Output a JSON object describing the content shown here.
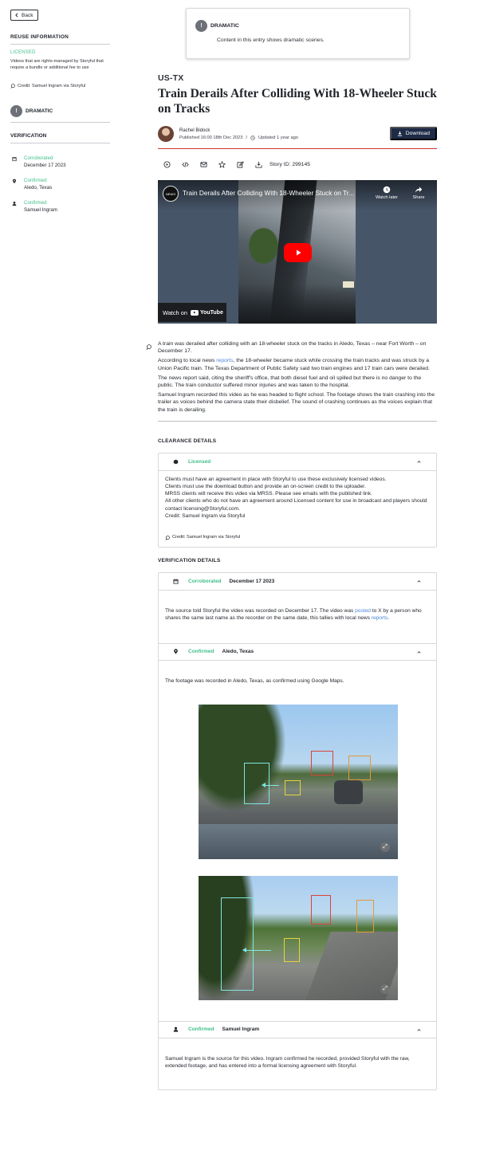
{
  "sidebar": {
    "back_label": "Back",
    "reuse_heading": "REUSE INFORMATION",
    "license_status": "LICENSED",
    "license_desc": "Videos that are rights-managed by Storyful that require a bundle or additional fee to use",
    "credit": "Credit: Samuel Ingram via Storyful",
    "dramatic_label": "DRAMATIC",
    "verification_heading": "VERIFICATION",
    "verification_items": [
      {
        "status": "Corroborated",
        "value": "December 17 2023",
        "icon": "calendar-icon"
      },
      {
        "status": "Confirmed",
        "value": "Aledo, Texas",
        "icon": "location-pin-icon"
      },
      {
        "status": "Confirmed",
        "value": "Samuel Ingram",
        "icon": "person-icon"
      }
    ]
  },
  "notice": {
    "title": "DRAMATIC",
    "text": "Content in this entry shows dramatic scenes."
  },
  "article": {
    "location": "US-TX",
    "headline": "Train Derails After Colliding With 18-Wheeler Stuck on Tracks",
    "author": "Rachel Bidock",
    "published": "Published 16:00 18th Dec 2023",
    "separator": "/",
    "updated": "Updated 1 year ago",
    "download_label": "Download",
    "story_id": "Story ID: 299145"
  },
  "video": {
    "channel_badge": "NEWS",
    "title": "Train Derails After Colliding With 18-Wheeler Stuck on Tr...",
    "watch_later": "Watch later",
    "share": "Share",
    "watch_on": "Watch on",
    "youtube": "YouTube"
  },
  "body": {
    "p1": "A train was derailed after colliding with an 18-wheeler stuck on the tracks in Aledo, Texas – near Fort Worth – on December 17.",
    "p2_before": "According to local news ",
    "p2_link": "reports",
    "p2_after": ", the 18-wheeler became stuck while crossing the train tracks and was struck by a Union Pacific train. The Texas Department of Public Safety said two train engines and 17 train cars were derailed.",
    "p3": "The news report said, citing the sheriff's office, that both diesel fuel and oil spilled but there is no danger to the public. The train conductor suffered minor injuries and was taken to the hospital.",
    "p4": "Samuel Ingram recorded this video as he was headed to flight school. The footage shows the train crashing into the trailer as voices behind the camera state their disbelief. The sound of crashing continues as the voices explain that the train is derailing."
  },
  "clearance": {
    "heading": "CLEARANCE DETAILS",
    "status": "Licensed",
    "lines": [
      "Clients must have an agreement in place with Storyful to use these exclusively licensed videos.",
      "Clients must use the download button and provide an on-screen credit to the uploader.",
      "MRSS clients will receive this video via MRSS. Please see emails with the published link.",
      "All other clients who do not have an agreement around Licensed content for use in broadcast and players should contact licensing@Storyful.com.",
      "Credit: Samuel Ingram via Storyful"
    ],
    "credit": "Credit: Samuel Ingram via Storyful"
  },
  "verification": {
    "heading": "VERIFICATION DETAILS",
    "date": {
      "status": "Corroborated",
      "value": "December 17 2023",
      "text_before": "The source told Storyful the video was recorded on December 17. The video was ",
      "link1": "posted",
      "text_mid": " to X by a person who shares the same last name as the recorder on the same date, this tallies with local news ",
      "link2": "reports",
      "text_end": "."
    },
    "location": {
      "status": "Confirmed",
      "value": "Aledo, Texas",
      "text": "The footage was recorded in Aledo, Texas, as confirmed using Google Maps."
    },
    "source": {
      "status": "Confirmed",
      "value": "Samuel Ingram",
      "text": "Samuel Ingram is the source for this video. Ingram confirmed he recorded, provided Storyful with the raw, extended footage, and has entered into a formal licensing agreement with Storyful."
    }
  },
  "colors": {
    "status_green": "#3fbf8a",
    "download_navy": "#1e2b47",
    "rule_red": "#c8392b",
    "link_blue": "#4a86d8",
    "box_cyan": "#7fe6e1",
    "box_red": "#d9443a",
    "box_orange": "#e59a35",
    "box_yellow": "#e8d33a"
  }
}
